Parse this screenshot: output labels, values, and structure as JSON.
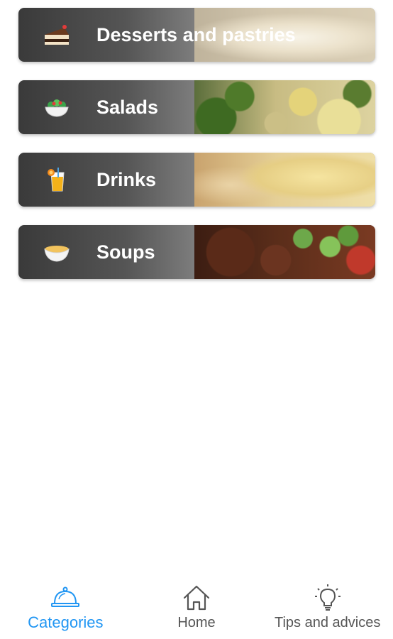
{
  "categories": [
    {
      "label": "Desserts and pastries",
      "icon": "cake-icon",
      "photo": "desserts"
    },
    {
      "label": "Salads",
      "icon": "salad-bowl-icon",
      "photo": "salads"
    },
    {
      "label": "Drinks",
      "icon": "juice-glass-icon",
      "photo": "drinks"
    },
    {
      "label": "Soups",
      "icon": "soup-bowl-icon",
      "photo": "soups"
    }
  ],
  "nav": {
    "active": "Categories",
    "items": [
      {
        "label": "Categories",
        "icon": "serving-cloche-icon"
      },
      {
        "label": "Home",
        "icon": "home-icon"
      },
      {
        "label": "Tips and advices",
        "icon": "lightbulb-icon"
      }
    ]
  },
  "colors": {
    "accent": "#2196f3",
    "nav_inactive": "#555555",
    "card_gradient_dark": "#3a3a3a"
  }
}
